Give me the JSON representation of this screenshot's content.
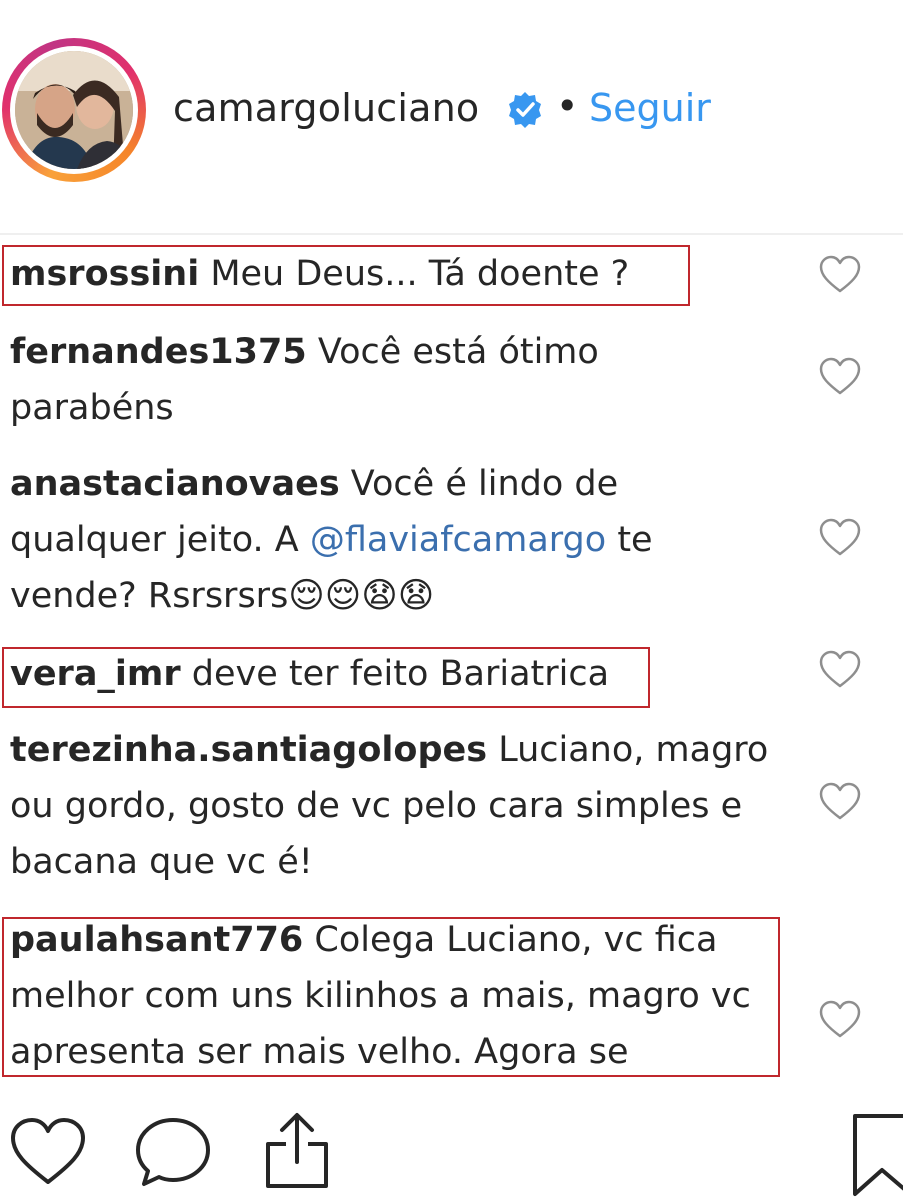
{
  "header": {
    "username": "camargoluciano",
    "separator": "•",
    "follow_label": "Seguir"
  },
  "comments": [
    {
      "user": "msrossini",
      "text": " Meu Deus... Tá doente ?",
      "highlighted": true
    },
    {
      "user": "fernandes1375",
      "text": " Você está ótimo parabéns",
      "highlighted": false
    },
    {
      "user": "anastacianovaes",
      "text_before": " Você é lindo de qualquer jeito. A ",
      "mention": "@flaviafcamargo",
      "text_after": " te vende? Rsrsrsrs😌😌😧😧",
      "highlighted": false
    },
    {
      "user": "vera_imr",
      "text": " deve ter feito Bariatrica",
      "highlighted": true
    },
    {
      "user": "terezinha.santiagolopes",
      "text": " Luciano, magro ou gordo, gosto de vc pelo cara simples e bacana que vc é!",
      "highlighted": false
    },
    {
      "user": "paulahsant776",
      "text": " Colega Luciano, vc fica melhor com uns kilinhos a mais, magro vc apresenta ser mais velho. Agora se",
      "highlighted": true
    }
  ],
  "actions": {
    "like_icon": "heart-outline-icon",
    "comment_icon": "speech-bubble-icon",
    "share_icon": "share-upload-icon",
    "save_icon": "bookmark-icon"
  },
  "colors": {
    "follow": "#3897f0",
    "mention": "#3b6fae",
    "highlight_box": "#c0272d",
    "verified_badge": "#3897f0"
  }
}
